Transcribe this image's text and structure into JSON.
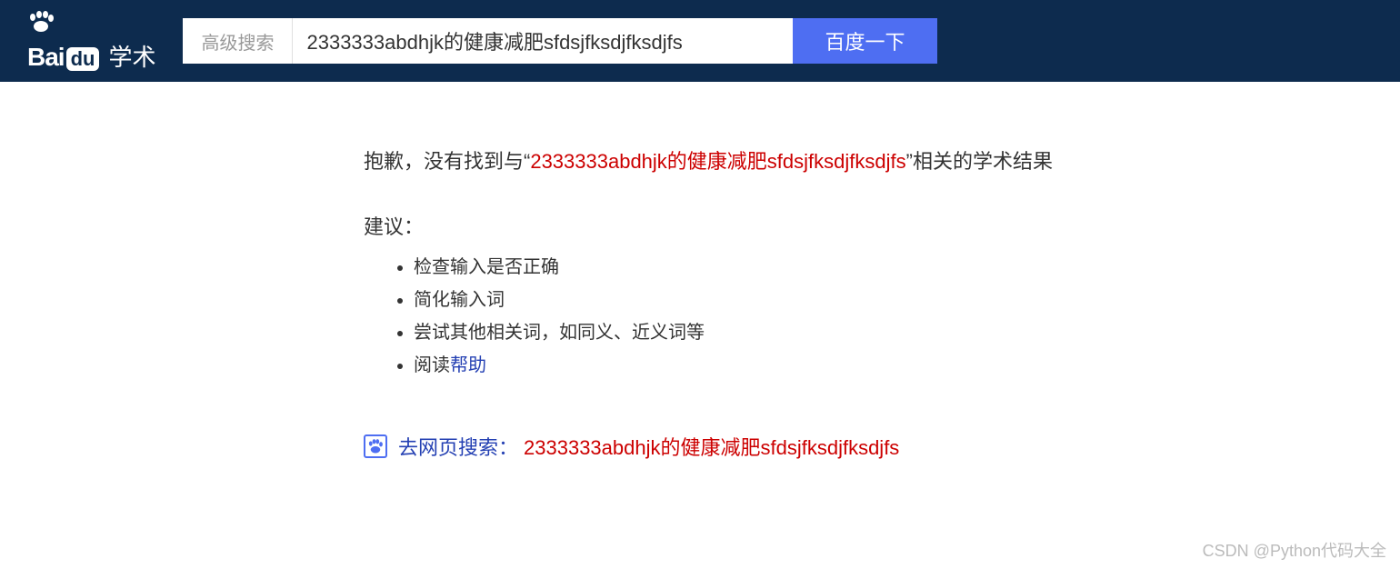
{
  "header": {
    "logo": {
      "bai": "Bai",
      "du": "du",
      "xueshu": "学术"
    },
    "advanced_search": "高级搜索",
    "search_value": "2333333abdhjk的健康减肥sfdsjfksdjfksdjfs",
    "search_button": "百度一下"
  },
  "results": {
    "no_results_prefix": "抱歉，没有找到与“",
    "no_results_query": "2333333abdhjk的健康减肥sfdsjfksdjfksdjfs",
    "no_results_suffix": "”相关的学术结果",
    "suggestions_title": "建议：",
    "suggestions": {
      "item1": "检查输入是否正确",
      "item2": "简化输入词",
      "item3": "尝试其他相关词，如同义、近义词等",
      "item4_prefix": "阅读",
      "item4_link": "帮助"
    },
    "web_search_label": "去网页搜索：",
    "web_search_query": "2333333abdhjk的健康减肥sfdsjfksdjfksdjfs"
  },
  "watermark": "CSDN @Python代码大全"
}
